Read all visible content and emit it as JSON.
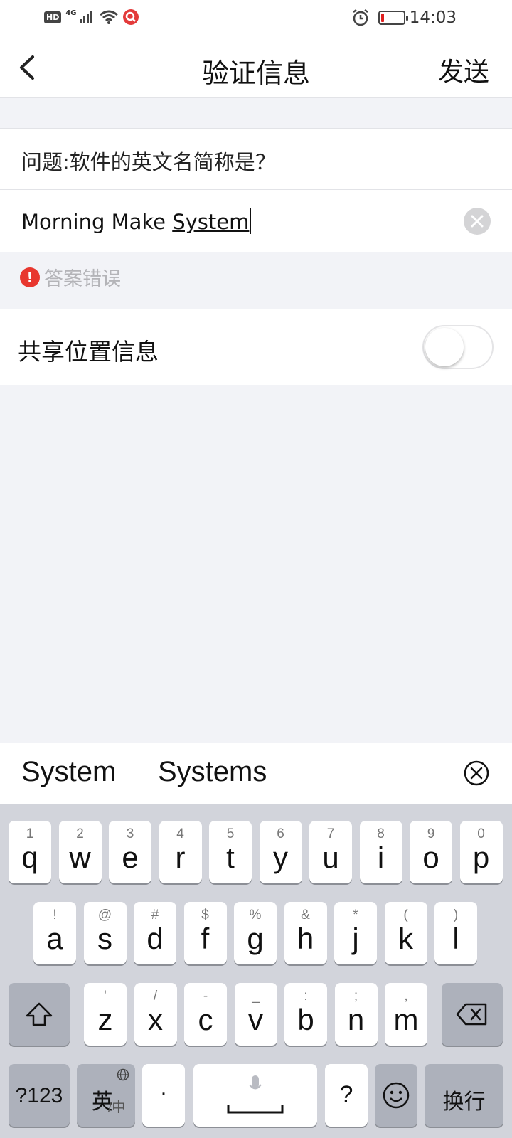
{
  "status_bar": {
    "hd": "HD",
    "network": "4G",
    "time": "14:03",
    "battery_color": "#e02020"
  },
  "nav": {
    "title": "验证信息",
    "send": "发送"
  },
  "form": {
    "question": "问题:软件的英文名简称是？",
    "answer_prefix": "Morning Make ",
    "answer_composing": "System",
    "error_icon": "!",
    "error_text": "答案错误",
    "share_label": "共享位置信息",
    "share_enabled": false
  },
  "suggestions": [
    "System",
    "Systems"
  ],
  "keyboard": {
    "row1": [
      {
        "k": "q",
        "s": "1"
      },
      {
        "k": "w",
        "s": "2"
      },
      {
        "k": "e",
        "s": "3"
      },
      {
        "k": "r",
        "s": "4"
      },
      {
        "k": "t",
        "s": "5"
      },
      {
        "k": "y",
        "s": "6"
      },
      {
        "k": "u",
        "s": "7"
      },
      {
        "k": "i",
        "s": "8"
      },
      {
        "k": "o",
        "s": "9"
      },
      {
        "k": "p",
        "s": "0"
      }
    ],
    "row2": [
      {
        "k": "a",
        "s": "!"
      },
      {
        "k": "s",
        "s": "@"
      },
      {
        "k": "d",
        "s": "#"
      },
      {
        "k": "f",
        "s": "$"
      },
      {
        "k": "g",
        "s": "%"
      },
      {
        "k": "h",
        "s": "&"
      },
      {
        "k": "j",
        "s": "*"
      },
      {
        "k": "k",
        "s": "("
      },
      {
        "k": "l",
        "s": ")"
      }
    ],
    "row3": [
      {
        "k": "z",
        "s": "'"
      },
      {
        "k": "x",
        "s": "/"
      },
      {
        "k": "c",
        "s": "-"
      },
      {
        "k": "v",
        "s": "_"
      },
      {
        "k": "b",
        "s": ":"
      },
      {
        "k": "n",
        "s": ";"
      },
      {
        "k": "m",
        "s": ","
      }
    ],
    "symbols_label": "?123",
    "lang_label": "英",
    "lang_sub": "中",
    "period_label": "·",
    "question_label": "?",
    "enter_label": "换行",
    "icons": [
      "shift-icon",
      "backspace-icon",
      "globe-icon",
      "microphone-icon",
      "emoji-icon"
    ]
  }
}
